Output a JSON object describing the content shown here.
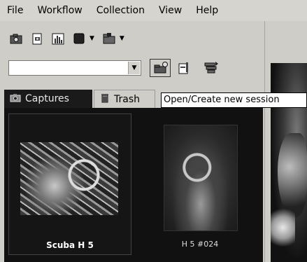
{
  "menu": [
    "File",
    "Workflow",
    "Collection",
    "View",
    "Help"
  ],
  "toolbar": {
    "row1_icons": [
      "camera-icon",
      "document-camera-icon",
      "histogram-icon",
      "stop-square-icon",
      "folder-icon"
    ],
    "session_select": {
      "value": ""
    },
    "row2_icons": [
      "open-create-session-icon",
      "folder-card-icon",
      "stack-icon"
    ]
  },
  "tabs": {
    "captures": "Captures",
    "trash": "Trash"
  },
  "tooltip": "Open/Create new session",
  "thumbnails": [
    {
      "label": "Scuba H 5"
    },
    {
      "label": "H 5 #024"
    }
  ]
}
